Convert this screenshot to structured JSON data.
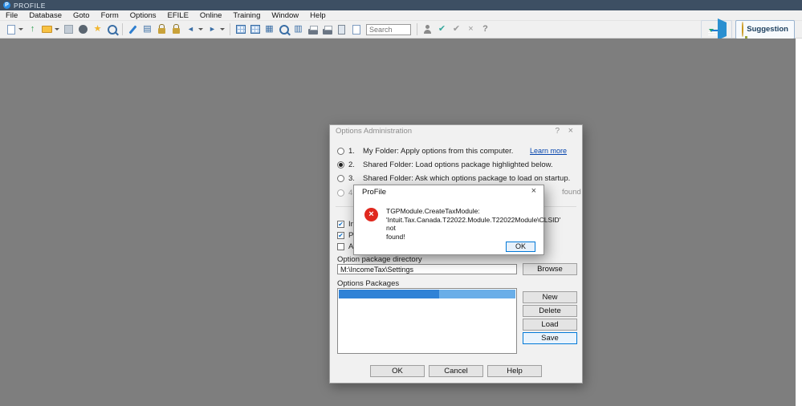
{
  "window": {
    "app_title": "PROFILE",
    "app_icon_letter": "P"
  },
  "menu": {
    "items": [
      "File",
      "Database",
      "Goto",
      "Form",
      "Options",
      "EFILE",
      "Online",
      "Training",
      "Window",
      "Help"
    ]
  },
  "toolbar": {
    "search_placeholder": "Search",
    "suggestion_label": "Suggestion",
    "icons": [
      "new-form-icon",
      "carryforward-icon",
      "open-folder-icon",
      "save-icon",
      "audit-icon",
      "favorites-star-icon",
      "print-preview-icon",
      "edit-icon",
      "form-explorer-icon",
      "lock-icon",
      "unlock-icon",
      "prev-form-icon",
      "next-form-icon",
      "t-slip-grid-icon",
      "table-icon",
      "summary-grid-icon",
      "zoom-icon",
      "spreadsheet-icon",
      "print-icon",
      "print-all-icon",
      "calculator-icon",
      "document-icon",
      "client-icon",
      "verify-icon",
      "reverify-icon",
      "cancel-icon",
      "help-icon",
      "chat-icon",
      "notifications-bell-icon",
      "send-icon",
      "suggestion-bulb-icon"
    ]
  },
  "options_dialog": {
    "title": "Options Administration",
    "help_glyph": "?",
    "close_glyph": "×",
    "learn_more_label": "Learn more",
    "radios": [
      {
        "num": "1.",
        "label": "My Folder: Apply options from this computer."
      },
      {
        "num": "2.",
        "label": "Shared Folder: Load options package highlighted below."
      },
      {
        "num": "3.",
        "label": "Shared Folder: Ask which options package to load on startup."
      },
      {
        "num": "4.",
        "label": "found"
      }
    ],
    "checkboxes": [
      {
        "label": "Inc",
        "checked": true
      },
      {
        "label": "Pro",
        "checked": true
      },
      {
        "label": "Allo",
        "checked": false
      }
    ],
    "package_dir_label": "Option package directory",
    "package_dir_value": "M:\\IncomeTax\\Settings",
    "browse_label": "Browse",
    "packages_label": "Options Packages",
    "buttons": {
      "new_label": "New",
      "delete_label": "Delete",
      "load_label": "Load",
      "save_label": "Save",
      "ok_label": "OK",
      "cancel_label": "Cancel",
      "help_label": "Help"
    }
  },
  "error_dialog": {
    "title": "ProFile",
    "close_glyph": "×",
    "error_glyph": "×",
    "message_lines": [
      "TGPModule.CreateTaxModule:",
      "'Intuit.Tax.Canada.T22022.Module.T22022Module\\CLSID' not",
      "found!"
    ],
    "ok_label": "OK"
  }
}
